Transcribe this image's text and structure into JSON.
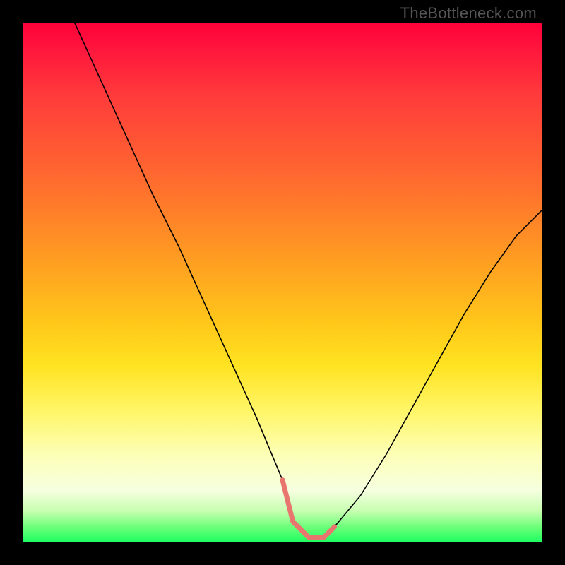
{
  "watermark": "TheBottleneck.com",
  "chart_data": {
    "type": "line",
    "title": "",
    "xlabel": "",
    "ylabel": "",
    "xlim": [
      0,
      100
    ],
    "ylim": [
      0,
      100
    ],
    "series": [
      {
        "name": "main-curve",
        "color": "#000000",
        "width": 1.6,
        "x": [
          10,
          15,
          20,
          25,
          30,
          35,
          40,
          45,
          50,
          52,
          55,
          58,
          60,
          65,
          70,
          75,
          80,
          85,
          90,
          95,
          100
        ],
        "y": [
          100,
          89,
          78,
          67,
          57,
          46,
          35,
          24,
          12,
          4,
          1,
          1,
          3,
          9,
          17,
          26,
          35,
          44,
          52,
          59,
          64
        ]
      },
      {
        "name": "highlight-segment",
        "color": "#e8766f",
        "width": 7,
        "x": [
          50,
          52,
          55,
          58,
          60
        ],
        "y": [
          12,
          4,
          1,
          1,
          3
        ]
      }
    ]
  }
}
